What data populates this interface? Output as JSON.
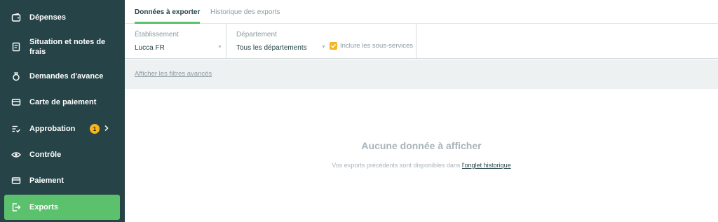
{
  "sidebar": {
    "items": [
      {
        "label": "Dépenses",
        "icon": "wallet-icon"
      },
      {
        "label": "Situation et notes de frais",
        "icon": "receipt-icon"
      },
      {
        "label": "Demandes d'avance",
        "icon": "money-bag-icon"
      },
      {
        "label": "Carte de paiement",
        "icon": "credit-card-icon"
      },
      {
        "label": "Approbation",
        "icon": "checklist-icon",
        "badge": "1"
      },
      {
        "label": "Contrôle",
        "icon": "eye-icon"
      },
      {
        "label": "Paiement",
        "icon": "payment-card-icon"
      },
      {
        "label": "Exports",
        "icon": "export-icon",
        "active": true
      }
    ]
  },
  "tabs": [
    {
      "label": "Données à exporter",
      "active": true
    },
    {
      "label": "Historique des exports",
      "active": false
    }
  ],
  "filters": {
    "etablissement": {
      "label": "Établissement",
      "value": "Lucca FR"
    },
    "departement": {
      "label": "Département",
      "value": "Tous les départements"
    },
    "include_subservices": {
      "label": "Inclure les sous-services",
      "checked": true
    }
  },
  "advanced_filters_link": "Afficher les filtres avancés",
  "empty_state": {
    "title": "Aucune donnée à afficher",
    "subtitle_prefix": "Vos exports précédents sont disponibles dans ",
    "subtitle_link": "l'onglet historique"
  },
  "colors": {
    "sidebar_bg": "#264447",
    "accent_green": "#5bc16d",
    "badge_yellow": "#f5b51f"
  }
}
